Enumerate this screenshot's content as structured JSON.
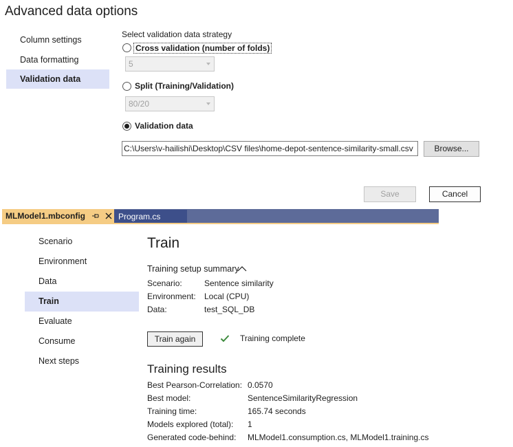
{
  "dialog": {
    "title": "Advanced data options",
    "nav": [
      "Column settings",
      "Data formatting",
      "Validation data"
    ],
    "strategy_label": "Select validation data strategy",
    "options": {
      "cross_validation": "Cross validation (number of folds)",
      "cross_validation_value": "5",
      "split": "Split (Training/Validation)",
      "split_value": "80/20",
      "validation_data": "Validation data"
    },
    "file_path": "C:\\Users\\v-hailishi\\Desktop\\CSV files\\home-depot-sentence-similarity-small.csv",
    "browse_label": "Browse...",
    "save_label": "Save",
    "cancel_label": "Cancel"
  },
  "tabs": {
    "active": "MLModel1.mbconfig",
    "other": "Program.cs"
  },
  "nav": [
    "Scenario",
    "Environment",
    "Data",
    "Train",
    "Evaluate",
    "Consume",
    "Next steps"
  ],
  "train": {
    "title": "Train",
    "setup_header": "Training setup summary",
    "setup": [
      {
        "label": "Scenario:",
        "value": "Sentence similarity"
      },
      {
        "label": "Environment:",
        "value": "Local (CPU)"
      },
      {
        "label": "Data:",
        "value": "test_SQL_DB"
      }
    ],
    "train_again_label": "Train again",
    "status": "Training complete",
    "results_title": "Training results",
    "results": [
      {
        "label": "Best Pearson-Correlation:",
        "value": "0.0570"
      },
      {
        "label": "Best model:",
        "value": "SentenceSimilarityRegression"
      },
      {
        "label": "Training time:",
        "value": "165.74 seconds"
      },
      {
        "label": "Models explored (total):",
        "value": "1"
      },
      {
        "label": "Generated code-behind:",
        "value": "MLModel1.consumption.cs, MLModel1.training.cs"
      }
    ]
  },
  "colors": {
    "selected_nav": "#dce1f7",
    "active_tab": "#f5cc84",
    "tab_strip": "#5d6b99",
    "check": "#3c8a3c"
  }
}
